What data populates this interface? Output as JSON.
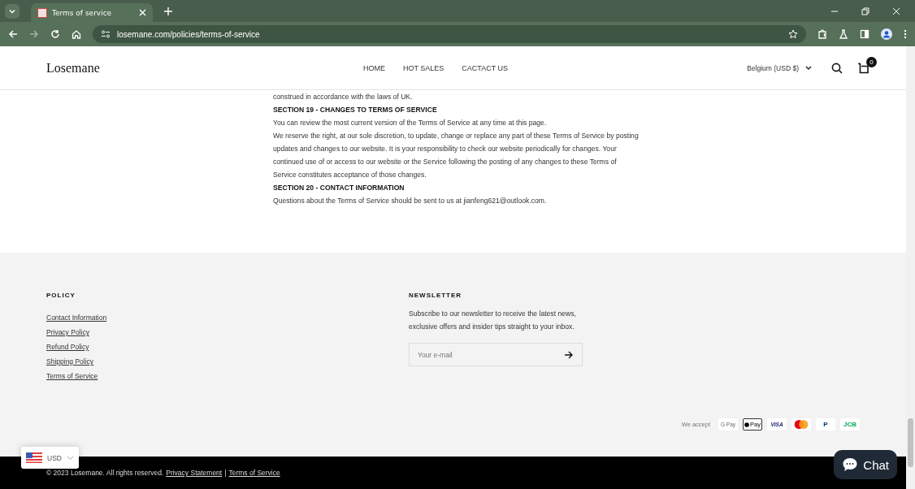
{
  "browser": {
    "tab_title": "Terms of service",
    "url": "losemane.com/policies/terms-of-service"
  },
  "header": {
    "logo": "Losemane",
    "nav": [
      {
        "label": "HOME"
      },
      {
        "label": "HOT SALES"
      },
      {
        "label": "CACTACT US"
      }
    ],
    "country": "Belgium (USD $)",
    "cart_count": "0"
  },
  "content": [
    {
      "kind": "text",
      "text": "construed in accordance with the laws of UK."
    },
    {
      "kind": "heading",
      "text": "SECTION 19 - CHANGES TO TERMS OF SERVICE"
    },
    {
      "kind": "text",
      "text": "You can review the most current version of the Terms of Service at any time at this page."
    },
    {
      "kind": "text",
      "text": "We reserve the right, at our sole discretion, to update, change or replace any part of these Terms of Service by posting updates and changes to our website. It is your responsibility to check our website periodically for changes. Your continued use of or access to our website or the Service following the posting of any changes to these Terms of Service constitutes acceptance of those changes."
    },
    {
      "kind": "heading",
      "text": "SECTION 20 - CONTACT INFORMATION"
    },
    {
      "kind": "text",
      "text": "Questions about the Terms of Service should be sent to us at  jianfeng621@outlook.com."
    }
  ],
  "footer": {
    "policy_title": "POLICY",
    "policy_links": [
      "Contact Information",
      "Privacy Policy",
      "Refund Policy",
      "Shipping Policy",
      "Terms of Service"
    ],
    "newsletter_title": "NEWSLETTER",
    "newsletter_text": "Subscribe to our newsletter to receive the latest news, exclusive offers and insider tips straight to your inbox.",
    "email_placeholder": "Your e-mail",
    "we_accept": "We accept",
    "payments": [
      {
        "kind": "gpay",
        "label": "G Pay"
      },
      {
        "kind": "applepay",
        "label": "Pay"
      },
      {
        "kind": "visa",
        "label": "VISA"
      },
      {
        "kind": "mastercard"
      },
      {
        "kind": "paypal",
        "label": "P"
      },
      {
        "kind": "jcb",
        "label": "JCB"
      }
    ],
    "copyright": "© 2023 Losemane. All rights reserved.",
    "bottom_links": [
      "Privacy Statement",
      "Terms of Service"
    ],
    "separator": "|"
  },
  "currency": "USD",
  "chat": "Chat"
}
